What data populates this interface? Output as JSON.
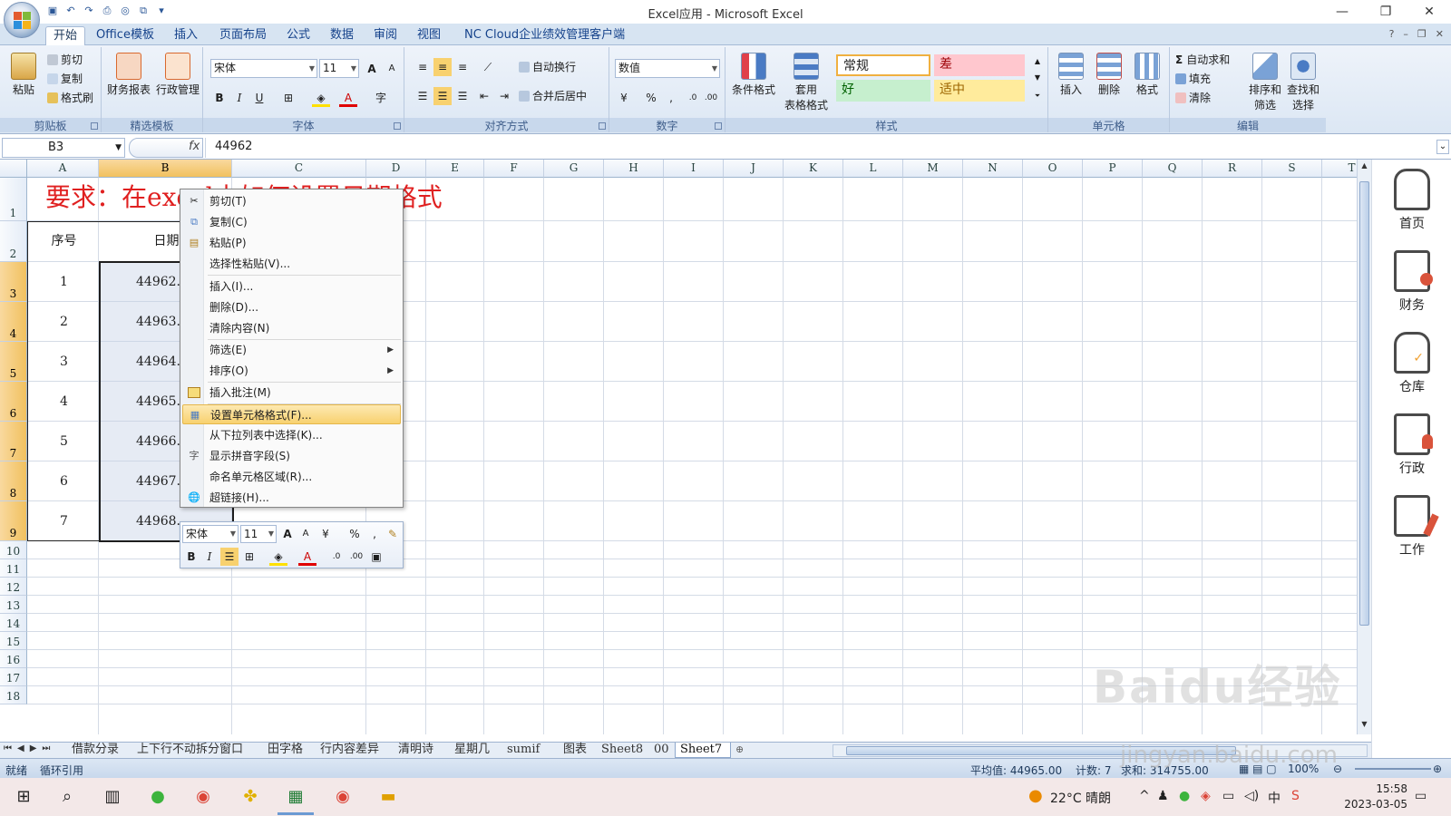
{
  "window": {
    "title": "Excel应用 - Microsoft Excel",
    "controls": [
      "—",
      "❐",
      "✕"
    ]
  },
  "ribbon": {
    "tabs": [
      "开始",
      "Office模板",
      "插入",
      "页面布局",
      "公式",
      "数据",
      "审阅",
      "视图",
      "NC Cloud企业绩效管理客户端"
    ],
    "clipboard": {
      "paste": "粘贴",
      "cut": "剪切",
      "copy": "复制",
      "format_painter": "格式刷",
      "label": "剪贴板"
    },
    "templates": {
      "finance": "财务报表",
      "admin": "行政管理",
      "label": "精选模板"
    },
    "font": {
      "name": "宋体",
      "size": "11",
      "bold": "B",
      "italic": "I",
      "underline": "U",
      "label": "字体",
      "grow": "A",
      "shrink": "A",
      "color_letter": "A"
    },
    "alignment": {
      "wrap": "自动换行",
      "merge": "合并后居中",
      "label": "对齐方式"
    },
    "number": {
      "format": "数值",
      "label": "数字",
      "percent": "%",
      "comma": ","
    },
    "styles": {
      "conditional": "条件格式",
      "table_line1": "套用",
      "table_line2": "表格格式",
      "normal": "常规",
      "bad": "差",
      "good": "好",
      "neutral": "适中",
      "label": "样式"
    },
    "cells": {
      "insert": "插入",
      "delete": "删除",
      "format": "格式",
      "label": "单元格"
    },
    "editing": {
      "autosum": "自动求和",
      "fill": "填充",
      "clear": "清除",
      "sort_line1": "排序和",
      "sort_line2": "筛选",
      "find_line1": "查找和",
      "find_line2": "选择",
      "label": "编辑"
    }
  },
  "formula_bar": {
    "name_box": "B3",
    "fx": "fx",
    "value": "44962"
  },
  "columns": [
    "A",
    "B",
    "C",
    "D",
    "E",
    "F",
    "G",
    "H",
    "I",
    "J",
    "K",
    "L",
    "M",
    "N",
    "O",
    "P",
    "Q",
    "R",
    "S",
    "T"
  ],
  "rows": [
    "1",
    "2",
    "3",
    "4",
    "5",
    "6",
    "7",
    "8",
    "9",
    "10",
    "11",
    "12",
    "13",
    "14",
    "15",
    "16",
    "17",
    "18"
  ],
  "sheet": {
    "title": "要求：在excel中如何设置日期格式",
    "header_seq": "序号",
    "header_date": "日期",
    "seq": [
      "1",
      "2",
      "3",
      "4",
      "5",
      "6",
      "7"
    ],
    "dates": [
      "44962.0",
      "44963.0",
      "44964.0",
      "44965.0",
      "44966.0",
      "44967.0",
      "44968.0"
    ]
  },
  "context_menu": {
    "items": [
      {
        "label": "剪切(T)",
        "icon": "scissors-icon"
      },
      {
        "label": "复制(C)",
        "icon": "copy-icon"
      },
      {
        "label": "粘贴(P)",
        "icon": "paste-icon"
      },
      {
        "label": "选择性粘贴(V)...",
        "icon": ""
      },
      {
        "label": "插入(I)...",
        "icon": ""
      },
      {
        "label": "删除(D)...",
        "icon": ""
      },
      {
        "label": "清除内容(N)",
        "icon": ""
      },
      {
        "label": "筛选(E)",
        "icon": ""
      },
      {
        "label": "排序(O)",
        "icon": ""
      },
      {
        "label": "插入批注(M)",
        "icon": "comment-icon"
      },
      {
        "label": "设置单元格格式(F)...",
        "icon": "format-cells-icon"
      },
      {
        "label": "从下拉列表中选择(K)...",
        "icon": ""
      },
      {
        "label": "显示拼音字段(S)",
        "icon": "phonetic-icon"
      },
      {
        "label": "命名单元格区域(R)...",
        "icon": ""
      },
      {
        "label": "超链接(H)...",
        "icon": "hyperlink-icon"
      }
    ]
  },
  "mini_toolbar": {
    "font": "宋体",
    "size": "11",
    "percent": "%",
    "comma": ",",
    "bold": "B",
    "italic": "I",
    "grow": "A",
    "shrink": "A",
    "color_letter": "A"
  },
  "sheet_tabs": [
    "借款分录",
    "上下行不动拆分窗口",
    "田字格",
    "行内容差异",
    "清明诗",
    "星期几",
    "sumif",
    "图表",
    "Sheet8",
    "00",
    "Sheet7"
  ],
  "status": {
    "ready": "就绪",
    "circular": "循环引用",
    "average": "平均值: 44965.00",
    "count": "计数: 7",
    "sum_partial": "求和: 314755.00",
    "zoom": "100%"
  },
  "side_panel": [
    "首页",
    "财务",
    "仓库",
    "行政",
    "工作"
  ],
  "taskbar": {
    "weather": "22°C 晴朗",
    "time": "15:58",
    "date": "2023-03-05"
  },
  "watermark": {
    "brand": "Baidu经验",
    "url": "jingyan.baidu.com"
  }
}
